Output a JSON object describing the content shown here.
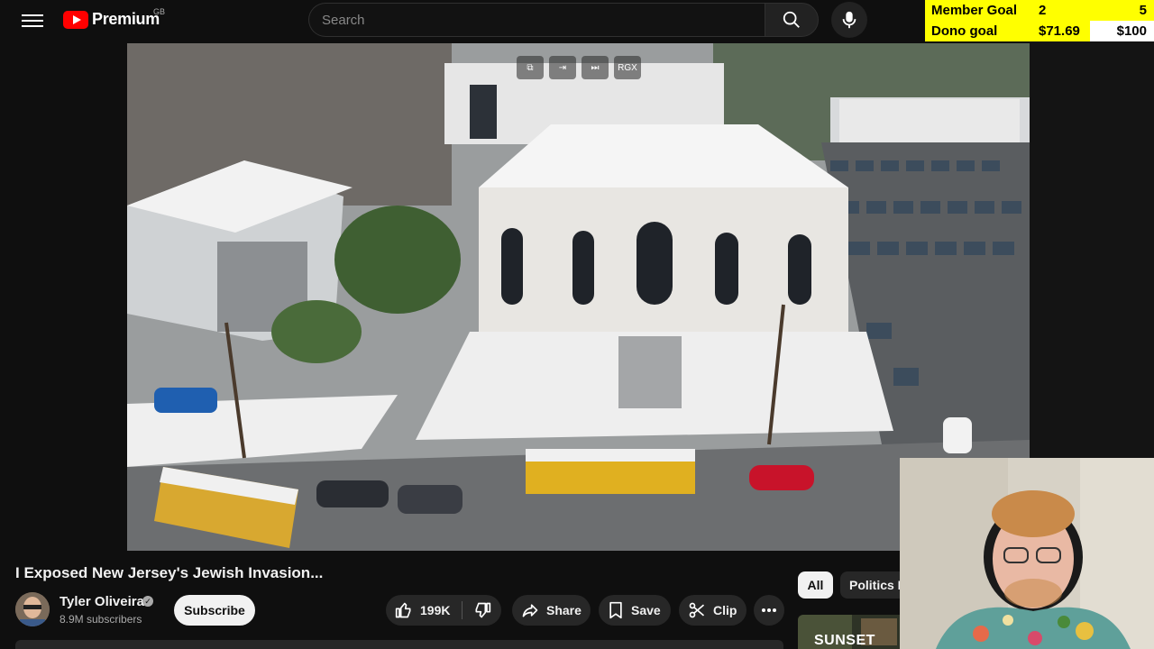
{
  "header": {
    "logo_text": "Premium",
    "country_code": "GB",
    "search_placeholder": "Search"
  },
  "goals": {
    "member_label": "Member Goal",
    "member_value": "2",
    "member_target": "5",
    "dono_label": "Dono goal",
    "dono_value": "$71.69",
    "dono_target": "$100",
    "dono_progress": 0.72
  },
  "player": {
    "mini_controls": [
      "external-link-icon",
      "enter-icon",
      "next-icon",
      "RGX"
    ],
    "rgx_label": "RGX"
  },
  "video": {
    "title": "I Exposed New Jersey's Jewish Invasion...",
    "channel": "Tyler Oliveira",
    "subscribers": "8.9M subscribers",
    "subscribe_label": "Subscribe",
    "likes": "199K",
    "share_label": "Share",
    "save_label": "Save",
    "clip_label": "Clip"
  },
  "sidebar": {
    "chips": [
      "All",
      "Politics N"
    ],
    "next_thumb_text": "SUNSET"
  }
}
